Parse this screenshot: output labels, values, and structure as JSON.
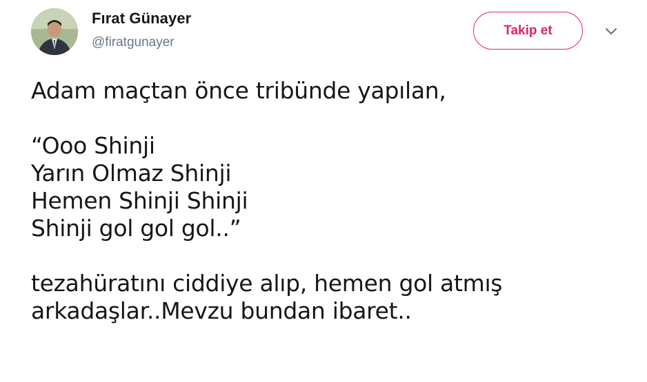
{
  "user": {
    "name": "Fırat Günayer",
    "handle": "@firatgunayer"
  },
  "follow_button": {
    "label": "Takip et"
  },
  "menu": {
    "icon": "chevron-down-icon"
  },
  "tweet": {
    "lines": [
      "Adam maçtan önce tribünde yapılan,",
      "",
      "“Ooo Shinji",
      "Yarın Olmaz Shinji",
      "Hemen Shinji Shinji",
      "Shinji gol gol gol..”",
      "",
      "tezahüratını ciddiye alıp, hemen gol atmış",
      "arkadaşlar..Mevzu bundan ibaret.."
    ]
  },
  "colors": {
    "accent": "#e0245e",
    "text": "#14171a",
    "secondary": "#657786"
  }
}
